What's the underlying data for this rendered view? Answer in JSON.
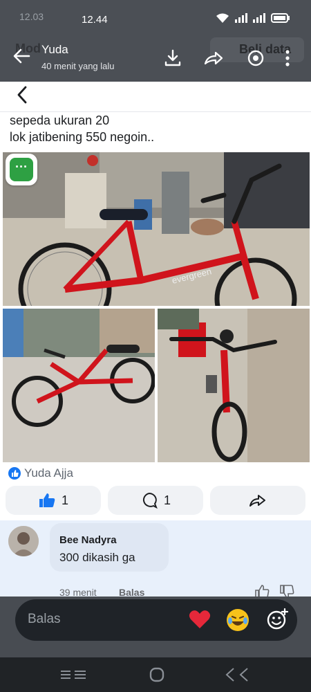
{
  "status_bar": {
    "time_ghost": "12.03",
    "time": "12.44"
  },
  "header": {
    "ghost_left": "Mod",
    "ghost_right": "Beli data",
    "poster_name": "Yuda",
    "posted_ago": "40 menit yang lalu"
  },
  "post": {
    "text_line1": "sepeda ukuran 20",
    "text_line2": "lok jatibening 550 negoin..",
    "bike_brand_text": "evergreen",
    "more_chip": "···",
    "reactor_name": "Yuda Ajja",
    "like_count": "1",
    "comment_count": "1"
  },
  "comment": {
    "author": "Bee Nadyra",
    "text": "300 dikasih ga",
    "age": "39 menit",
    "reply_label": "Balas"
  },
  "reply_bar": {
    "placeholder": "Balas"
  },
  "colors": {
    "accent": "#1877f2",
    "bike_red": "#d0141c",
    "chip_green": "#2ea043"
  }
}
